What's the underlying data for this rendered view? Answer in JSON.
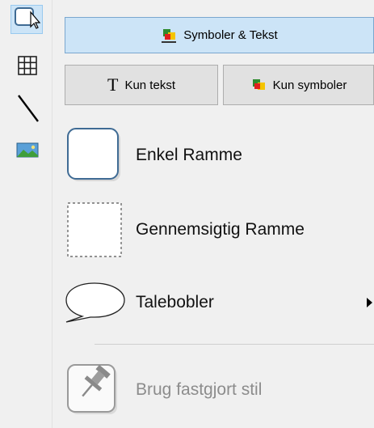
{
  "rail": {
    "items": [
      {
        "icon": "frame-icon",
        "selected": true
      },
      {
        "icon": "grid-icon",
        "selected": false
      },
      {
        "icon": "line-icon",
        "selected": false
      },
      {
        "icon": "image-icon",
        "selected": false
      }
    ]
  },
  "toolbar": {
    "symbols_text_label": "Symboler & Tekst",
    "text_only_label": "Kun tekst",
    "symbols_only_label": "Kun symboler",
    "text_icon_glyph": "T"
  },
  "menu": {
    "items": [
      {
        "label": "Enkel Ramme",
        "icon": "simple-frame-icon",
        "enabled": true
      },
      {
        "label": "Gennemsigtig Ramme",
        "icon": "transparent-frame-icon",
        "enabled": true
      },
      {
        "label": "Talebobler",
        "icon": "speech-bubble-icon",
        "enabled": true,
        "submenu": true
      },
      {
        "label": "Brug fastgjort stil",
        "icon": "pin-icon",
        "enabled": false
      }
    ]
  },
  "colors": {
    "active_button": "#cce4f7",
    "disabled_text": "#8c8c8c",
    "frame_border": "#3f6b94"
  }
}
